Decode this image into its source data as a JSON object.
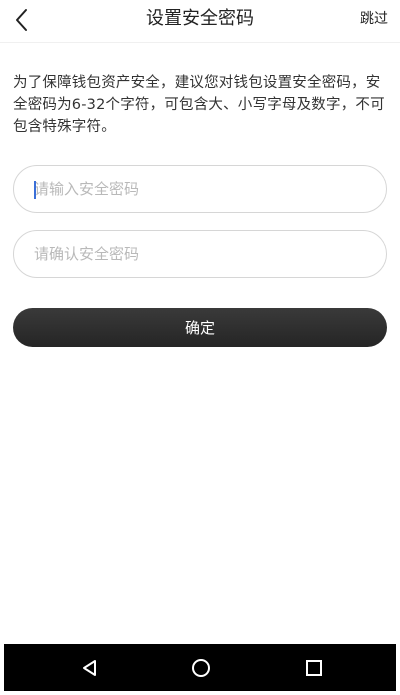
{
  "header": {
    "title": "设置安全密码",
    "skip_label": "跳过",
    "back_icon": "chevron-left-icon"
  },
  "description": "为了保障钱包资产安全，建议您对钱包设置安全密码，安全密码为6-32个字符，可包含大、小写字母及数字，不可包含特殊字符。",
  "form": {
    "password_placeholder": "请输入安全密码",
    "password_value": "",
    "confirm_placeholder": "请确认安全密码",
    "confirm_value": "",
    "submit_label": "确定"
  },
  "navbar": {
    "back_icon": "triangle-back-icon",
    "home_icon": "circle-home-icon",
    "recent_icon": "square-recent-icon"
  },
  "colors": {
    "primary_button": "#2c2c2c",
    "navbar": "#000000",
    "caret": "#3a6fd8",
    "placeholder": "#b9b9b9"
  }
}
